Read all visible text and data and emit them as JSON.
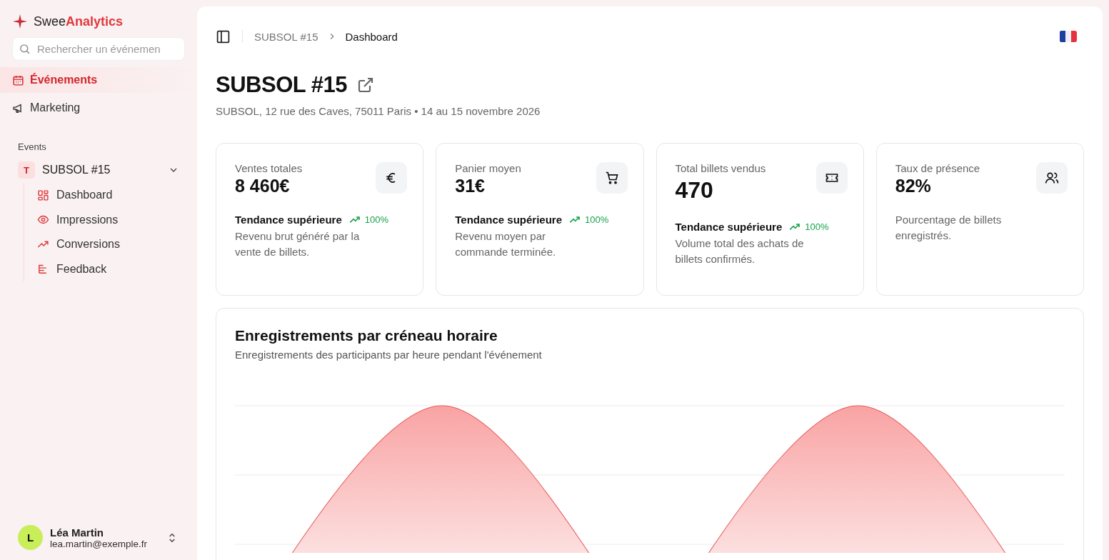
{
  "brand": {
    "first": "Swee",
    "second": "Analytics"
  },
  "search": {
    "placeholder": "Rechercher un événemen"
  },
  "nav": [
    {
      "label": "Événements",
      "selected": true
    },
    {
      "label": "Marketing",
      "selected": false
    }
  ],
  "events_section": {
    "title": "Events",
    "event": {
      "badge": "T",
      "name": "SUBSOL #15",
      "expanded": true,
      "children": [
        {
          "label": "Dashboard"
        },
        {
          "label": "Impressions"
        },
        {
          "label": "Conversions"
        },
        {
          "label": "Feedback"
        }
      ]
    }
  },
  "user": {
    "initial": "L",
    "name": "Léa Martin",
    "email": "lea.martin@exemple.fr"
  },
  "breadcrumb": [
    {
      "label": "SUBSOL #15",
      "selected": false
    },
    {
      "label": "Dashboard",
      "selected": true
    }
  ],
  "page": {
    "title": "SUBSOL #15",
    "subtitle": "SUBSOL, 12 rue des Caves, 75011 Paris • 14 au 15 novembre 2026"
  },
  "stats": [
    {
      "label": "Ventes totales",
      "value": "8 460€",
      "trend": "Tendance supérieure",
      "change": "100%",
      "description": "Revenu brut généré par la vente de billets."
    },
    {
      "label": "Panier moyen",
      "value": "31€",
      "trend": "Tendance supérieure",
      "change": "100%",
      "description": "Revenu moyen par commande terminée."
    },
    {
      "label": "Total billets vendus",
      "value": "470",
      "trend": "Tendance supérieure",
      "change": "100%",
      "description": "Volume total des achats de billets confirmés."
    },
    {
      "label": "Taux de présence",
      "value": "82%",
      "description": "Pourcentage de billets enregistrés."
    }
  ],
  "chart_card": {
    "title": "Enregistrements par créneau horaire",
    "subtitle": "Enregistrements des participants par heure pendant l'événement"
  }
}
